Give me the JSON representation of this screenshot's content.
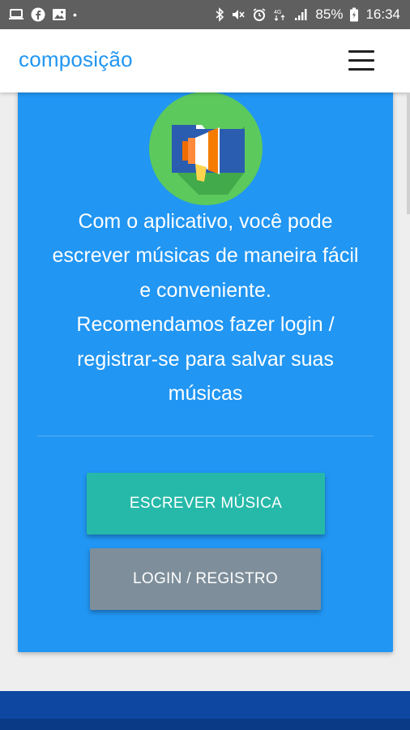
{
  "status_bar": {
    "left_icons": [
      "laptop-icon",
      "facebook-icon",
      "image-icon",
      "dot-icon"
    ],
    "right_icons": [
      "bluetooth-icon",
      "mute-icon",
      "alarm-icon",
      "4g-icon",
      "signal-icon"
    ],
    "battery": "85%",
    "time": "16:34"
  },
  "appbar": {
    "title": "composição",
    "menu_icon": "hamburger-menu-icon"
  },
  "card": {
    "icon": "folder-megaphone-icon",
    "description_lines": [
      "Com o aplicativo, você pode",
      "escrever músicas de maneira fácil",
      "e conveniente.",
      "Recomendamos fazer login /",
      "registrar-se para salvar suas",
      "músicas"
    ],
    "write_button": "ESCREVER MÚSICA",
    "login_button": "LOGIN / REGISTRO"
  },
  "colors": {
    "status_bar": "#5f5f5f",
    "accent": "#2196f3",
    "card_bg": "#2196f3",
    "write_button": "#26b9a9",
    "login_button": "#7e8f9b",
    "footer": "#0d47a1",
    "icon_circle": "#5cc95c"
  }
}
